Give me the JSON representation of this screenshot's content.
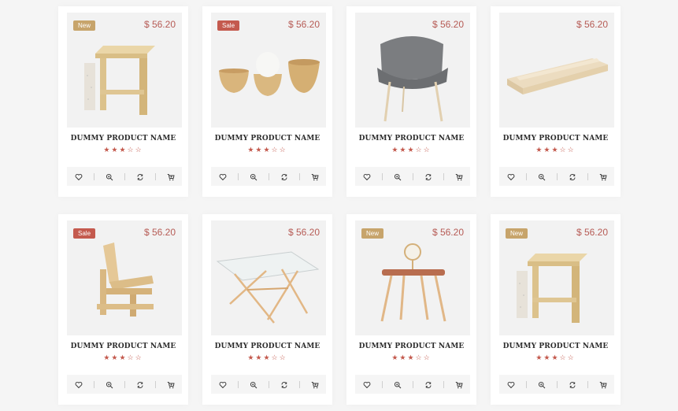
{
  "products": [
    {
      "badge": "New",
      "badge_type": "new",
      "price": "$ 56.20",
      "name": "DUMMY PRODUCT NAME",
      "rating": 3.5,
      "stars": "★★★☆☆",
      "image": "wooden-stool-image"
    },
    {
      "badge": "Sale",
      "badge_type": "sale",
      "price": "$ 56.20",
      "name": "DUMMY PRODUCT NAME",
      "rating": 3.5,
      "stars": "★★★☆☆",
      "image": "wooden-bowls-image"
    },
    {
      "badge": "",
      "badge_type": "",
      "price": "$ 56.20",
      "name": "DUMMY PRODUCT NAME",
      "rating": 3.5,
      "stars": "★★★☆☆",
      "image": "grey-chair-image"
    },
    {
      "badge": "",
      "badge_type": "",
      "price": "$ 56.20",
      "name": "DUMMY PRODUCT NAME",
      "rating": 3.5,
      "stars": "★★★☆☆",
      "image": "wooden-shelf-image"
    },
    {
      "badge": "Sale",
      "badge_type": "sale",
      "price": "$ 56.20",
      "name": "DUMMY PRODUCT NAME",
      "rating": 3.5,
      "stars": "★★★☆☆",
      "image": "wooden-lounge-chair-image"
    },
    {
      "badge": "",
      "badge_type": "",
      "price": "$ 56.20",
      "name": "DUMMY PRODUCT NAME",
      "rating": 3.5,
      "stars": "★★★☆☆",
      "image": "glass-table-image"
    },
    {
      "badge": "New",
      "badge_type": "new",
      "price": "$ 56.20",
      "name": "DUMMY PRODUCT NAME",
      "rating": 3.5,
      "stars": "★★★☆☆",
      "image": "vanity-desk-image"
    },
    {
      "badge": "New",
      "badge_type": "new",
      "price": "$ 56.20",
      "name": "DUMMY PRODUCT NAME",
      "rating": 3.5,
      "stars": "★★★☆☆",
      "image": "wooden-stool-image"
    }
  ],
  "actions": [
    {
      "icon": "heart-icon",
      "name": "wishlist-button"
    },
    {
      "icon": "zoom-icon",
      "name": "quick-view-button"
    },
    {
      "icon": "compare-icon",
      "name": "compare-button"
    },
    {
      "icon": "cart-icon",
      "name": "add-to-cart-button"
    }
  ],
  "colors": {
    "accent": "#c45a4e",
    "price": "#b65b55",
    "new_badge": "#c7a46b",
    "sale_badge": "#c45a4e"
  }
}
